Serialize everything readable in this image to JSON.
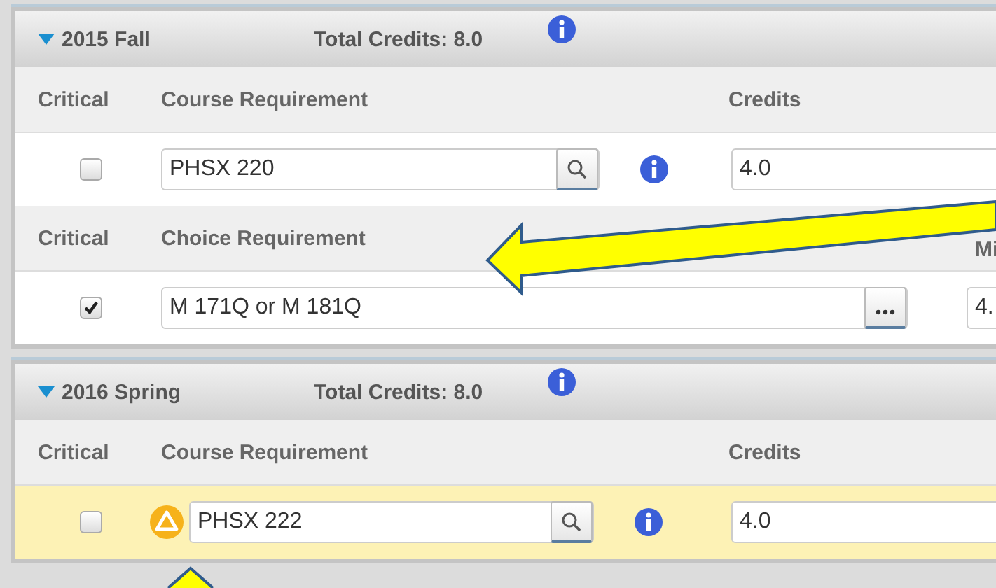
{
  "terms": [
    {
      "title": "2015 Fall",
      "expanded": true,
      "total": "Total Credits: 8.0",
      "groups": [
        {
          "kind": "course",
          "columns": [
            "Critical",
            "Course Requirement",
            "Credits"
          ],
          "rows": [
            {
              "critical": false,
              "warning": false,
              "highlighted": false,
              "value": "PHSX 220",
              "credits": "4.0"
            }
          ]
        },
        {
          "kind": "choice",
          "columns": [
            "Critical",
            "Choice Requirement",
            "Mi"
          ],
          "rows": [
            {
              "critical": true,
              "warning": false,
              "highlighted": false,
              "value": "M 171Q or M 181Q",
              "credits": "4."
            }
          ]
        }
      ]
    },
    {
      "title": "2016 Spring",
      "expanded": true,
      "total": "Total Credits: 8.0",
      "groups": [
        {
          "kind": "course",
          "columns": [
            "Critical",
            "Course Requirement",
            "Credits"
          ],
          "rows": [
            {
              "critical": false,
              "warning": true,
              "highlighted": true,
              "value": "PHSX 222",
              "credits": "4.0"
            }
          ]
        }
      ]
    }
  ]
}
